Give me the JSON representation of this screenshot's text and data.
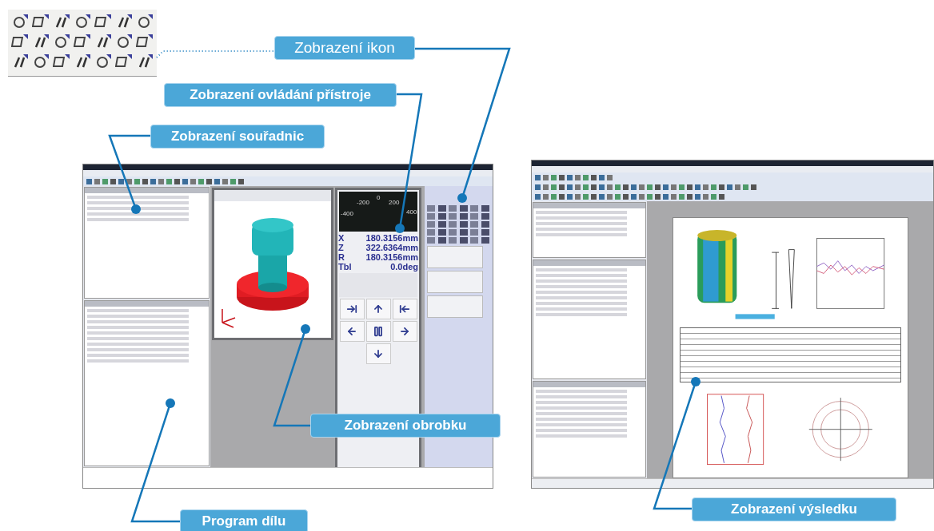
{
  "callouts": [
    {
      "label": "Zobrazení ikon",
      "bold": false,
      "dotted": true
    },
    {
      "label": "Zobrazení ovládání přístroje",
      "bold": true,
      "dotted": false
    },
    {
      "label": "Zobrazení souřadnic",
      "bold": true,
      "dotted": false
    },
    {
      "label": "Zobrazení obrobku",
      "bold": true,
      "dotted": false
    },
    {
      "label": "Program dílu",
      "bold": true,
      "dotted": false
    },
    {
      "label": "Zobrazení výsledku",
      "bold": true,
      "dotted": false
    }
  ],
  "machine_control": {
    "dial_labels": [
      "-200",
      "0",
      "200",
      "-400",
      "400"
    ],
    "readouts": [
      {
        "axis": "X",
        "value": "180.3156mm"
      },
      {
        "axis": "Z",
        "value": "322.6364mm"
      },
      {
        "axis": "R",
        "value": "180.3156mm"
      },
      {
        "axis": "Tbl",
        "value": "0.0deg"
      }
    ]
  }
}
